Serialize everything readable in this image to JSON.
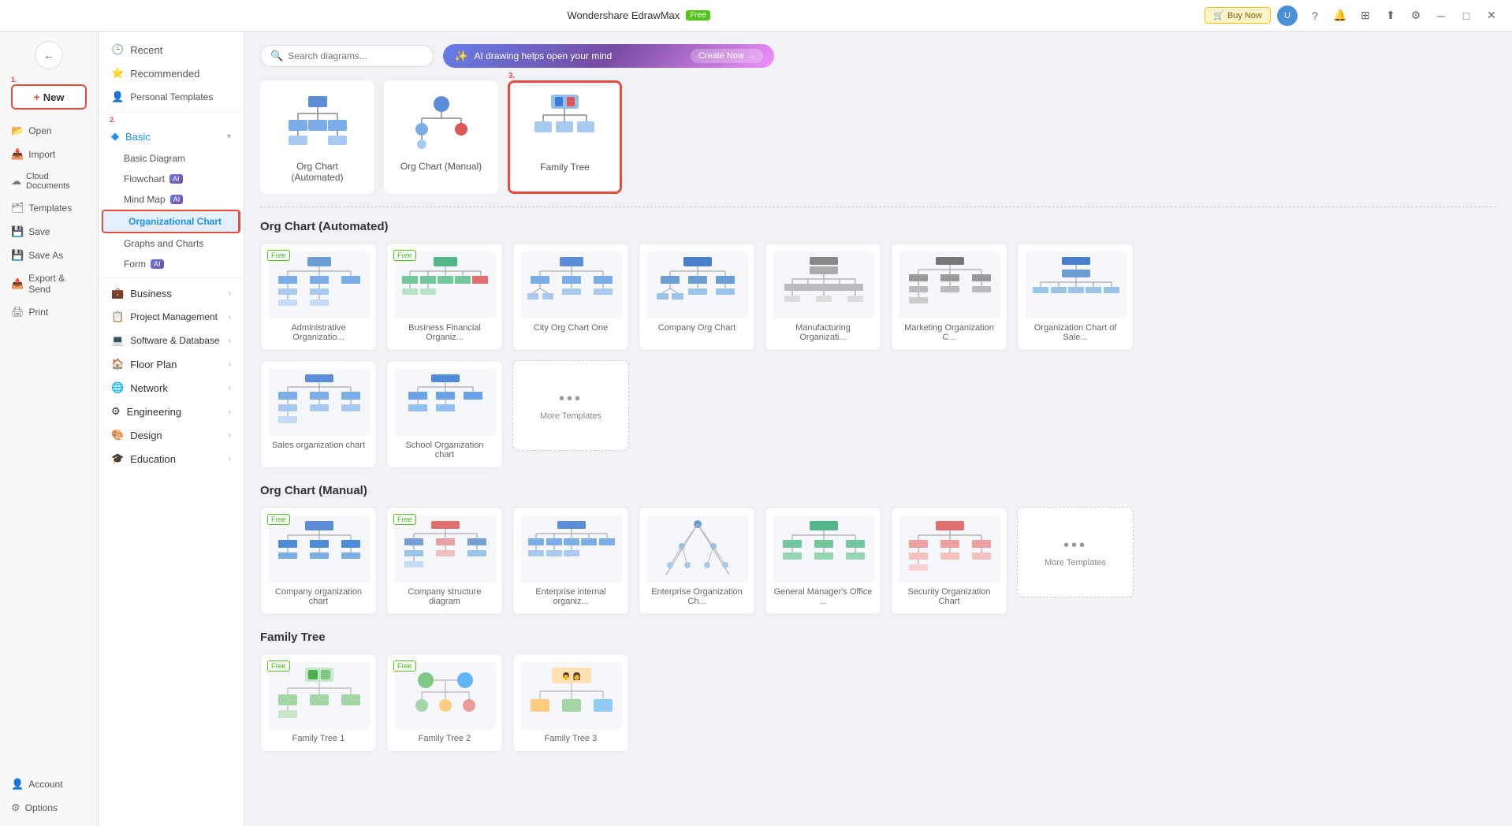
{
  "app": {
    "title": "Wondershare EdrawMax",
    "badge": "Free",
    "buy_label": "Buy Now"
  },
  "sidebar": {
    "back_title": "Back",
    "new_label": "New",
    "items": [
      {
        "id": "open",
        "label": "Open",
        "icon": "📂"
      },
      {
        "id": "import",
        "label": "Import",
        "icon": "📥"
      },
      {
        "id": "cloud",
        "label": "Cloud Documents",
        "icon": "☁"
      },
      {
        "id": "templates",
        "label": "Templates",
        "icon": "🗂"
      },
      {
        "id": "save",
        "label": "Save",
        "icon": "💾"
      },
      {
        "id": "save-as",
        "label": "Save As",
        "icon": "💾"
      },
      {
        "id": "export",
        "label": "Export & Send",
        "icon": "📤"
      },
      {
        "id": "print",
        "label": "Print",
        "icon": "🖨"
      }
    ],
    "bottom": [
      {
        "id": "account",
        "label": "Account",
        "icon": "👤"
      },
      {
        "id": "options",
        "label": "Options",
        "icon": "⚙"
      }
    ]
  },
  "left_nav": {
    "items": [
      {
        "id": "recent",
        "label": "Recent",
        "type": "top"
      },
      {
        "id": "recommended",
        "label": "Recommended",
        "type": "top"
      },
      {
        "id": "personal",
        "label": "Personal Templates",
        "type": "top"
      }
    ],
    "sections": [
      {
        "id": "basic",
        "label": "Basic",
        "color": "#1890ff",
        "children": [
          {
            "id": "basic-diagram",
            "label": "Basic Diagram"
          },
          {
            "id": "flowchart",
            "label": "Flowchart",
            "ai": true
          },
          {
            "id": "mind-map",
            "label": "Mind Map",
            "ai": true
          },
          {
            "id": "org-chart",
            "label": "Organizational Chart",
            "active": true
          }
        ]
      },
      {
        "id": "graphs",
        "label": "Graphs and Charts"
      },
      {
        "id": "form",
        "label": "Form",
        "ai": true
      },
      {
        "id": "business",
        "label": "Business"
      },
      {
        "id": "project",
        "label": "Project Management"
      },
      {
        "id": "software",
        "label": "Software & Database"
      },
      {
        "id": "floor",
        "label": "Floor Plan"
      },
      {
        "id": "network",
        "label": "Network"
      },
      {
        "id": "engineering",
        "label": "Engineering"
      },
      {
        "id": "design",
        "label": "Design"
      },
      {
        "id": "education",
        "label": "Education"
      }
    ]
  },
  "search": {
    "placeholder": "Search diagrams..."
  },
  "ai_bar": {
    "text": "AI drawing helps open your mind",
    "button": "Create Now →"
  },
  "top_templates": [
    {
      "id": "org-auto",
      "label": "Org Chart (Automated)",
      "selected": false
    },
    {
      "id": "org-manual",
      "label": "Org Chart (Manual)",
      "selected": false
    },
    {
      "id": "family-tree",
      "label": "Family Tree",
      "selected": true
    }
  ],
  "sections": [
    {
      "id": "org-automated",
      "title": "Org Chart (Automated)",
      "cards": [
        {
          "id": "admin-org",
          "label": "Administrative Organizatio...",
          "free": true
        },
        {
          "id": "biz-fin-org",
          "label": "Business Financial Organiz...",
          "free": true
        },
        {
          "id": "city-org",
          "label": "City Org Chart One",
          "free": false
        },
        {
          "id": "company-org",
          "label": "Company Org Chart",
          "free": false
        },
        {
          "id": "mfg-org",
          "label": "Manufacturing Organizati...",
          "free": false
        },
        {
          "id": "mkt-org",
          "label": "Marketing Organization C...",
          "free": false
        },
        {
          "id": "sale-org",
          "label": "Organization Chart of Sale...",
          "free": false
        }
      ],
      "row2": [
        {
          "id": "sales-org-chart",
          "label": "Sales organization chart",
          "free": false
        },
        {
          "id": "school-org",
          "label": "School Organization chart",
          "free": false
        }
      ],
      "has_more": true
    },
    {
      "id": "org-manual",
      "title": "Org Chart (Manual)",
      "cards": [
        {
          "id": "company-org-chart",
          "label": "Company organization chart",
          "free": true
        },
        {
          "id": "company-struct",
          "label": "Company structure diagram",
          "free": true
        },
        {
          "id": "enterprise-internal",
          "label": "Enterprise internal organiz...",
          "free": false
        },
        {
          "id": "enterprise-org",
          "label": "Enterprise Organization Ch...",
          "free": false
        },
        {
          "id": "gm-office",
          "label": "General Manager's Office ...",
          "free": false
        },
        {
          "id": "security-org",
          "label": "Security Organization Chart",
          "free": false
        }
      ],
      "has_more": true
    },
    {
      "id": "family-tree",
      "title": "Family Tree",
      "cards": [
        {
          "id": "family-tree-1",
          "label": "Family Tree 1",
          "free": true
        },
        {
          "id": "family-tree-2",
          "label": "Family Tree 2",
          "free": true
        },
        {
          "id": "family-tree-3",
          "label": "Family Tree 3",
          "free": false
        }
      ],
      "has_more": false
    }
  ],
  "step_labels": {
    "step1": "1.",
    "step2": "2.",
    "step3": "3."
  }
}
